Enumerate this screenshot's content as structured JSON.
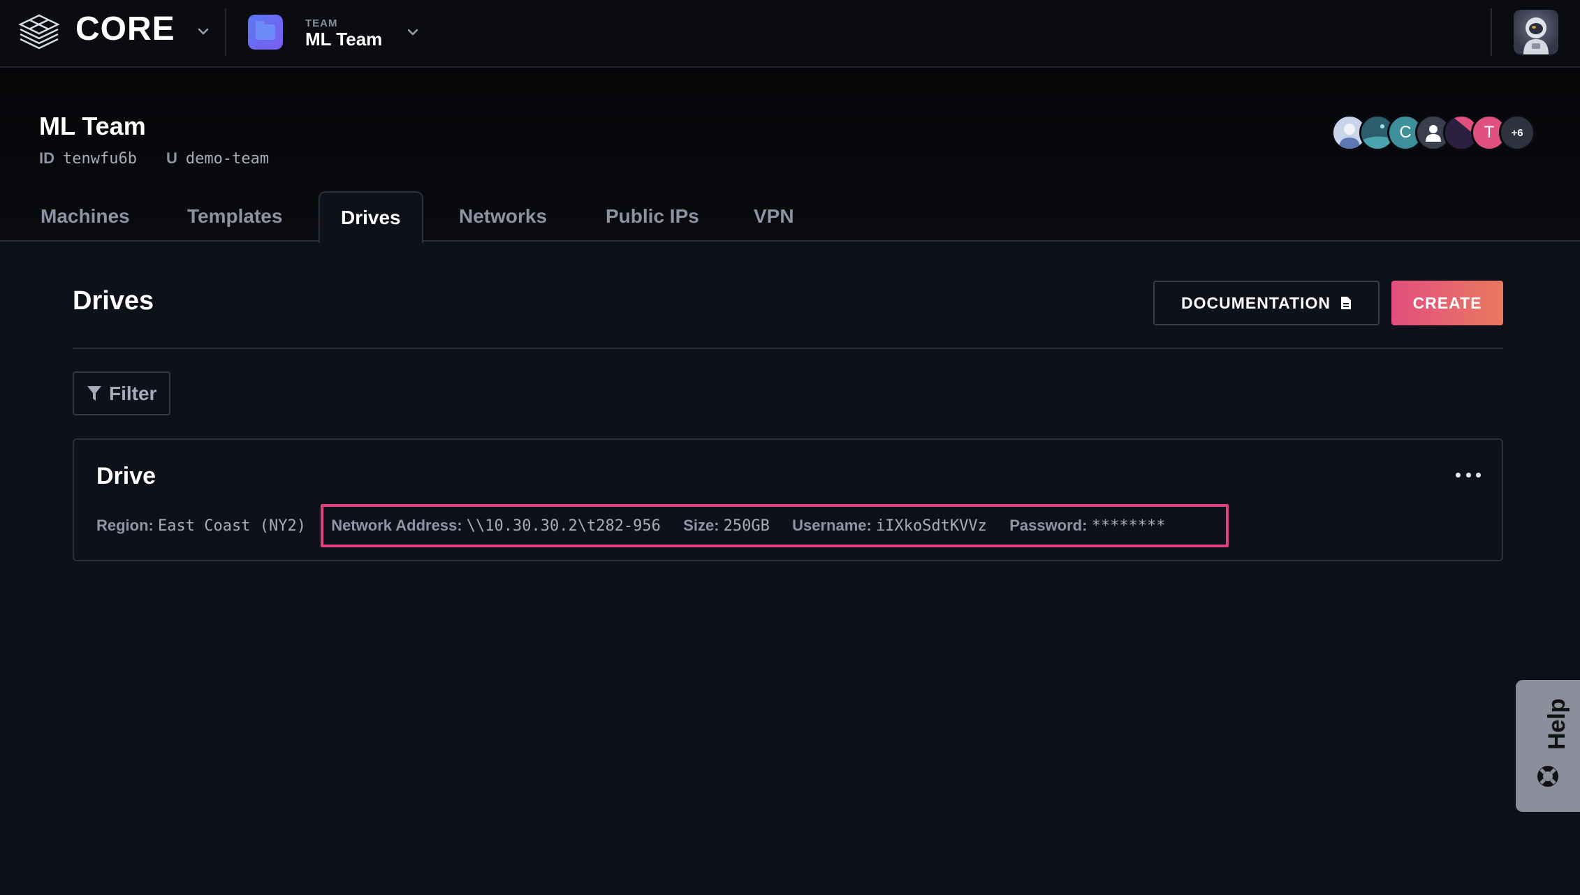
{
  "topbar": {
    "brand": "CORE",
    "team_caption": "TEAM",
    "team_name": "ML Team"
  },
  "header": {
    "title": "ML Team",
    "id_key": "ID",
    "id_value": "tenwfu6b",
    "user_key": "U",
    "user_value": "demo-team",
    "members": [
      {
        "kind": "photo",
        "color": "#c9d3ea"
      },
      {
        "kind": "photo",
        "color": "#3c7f8c"
      },
      {
        "kind": "letter",
        "letter": "C",
        "color": "#3d8f9c"
      },
      {
        "kind": "icon",
        "color": "#3b3f4d"
      },
      {
        "kind": "photo",
        "color": "#c43a6a"
      },
      {
        "kind": "letter",
        "letter": "T",
        "color": "#e0507e"
      }
    ],
    "members_more": "+6",
    "tabs": [
      "Machines",
      "Templates",
      "Drives",
      "Networks",
      "Public IPs",
      "VPN"
    ],
    "active_tab": "Drives"
  },
  "main": {
    "title": "Drives",
    "documentation_label": "DOCUMENTATION",
    "create_label": "CREATE",
    "filter_label": "Filter",
    "drive": {
      "title": "Drive",
      "region_label": "Region:",
      "region_value": "East Coast (NY2)",
      "network_label": "Network Address:",
      "network_value": "\\\\10.30.30.2\\t282-956",
      "size_label": "Size:",
      "size_value": "250GB",
      "username_label": "Username:",
      "username_value": "iIXkoSdtKVVz",
      "password_label": "Password:",
      "password_value": "********"
    }
  },
  "help": {
    "label": "Help"
  },
  "colors": {
    "accent_pink": "#e24e7e",
    "accent_orange": "#e9795f",
    "highlight": "#e0407e",
    "background": "#0f111a"
  }
}
